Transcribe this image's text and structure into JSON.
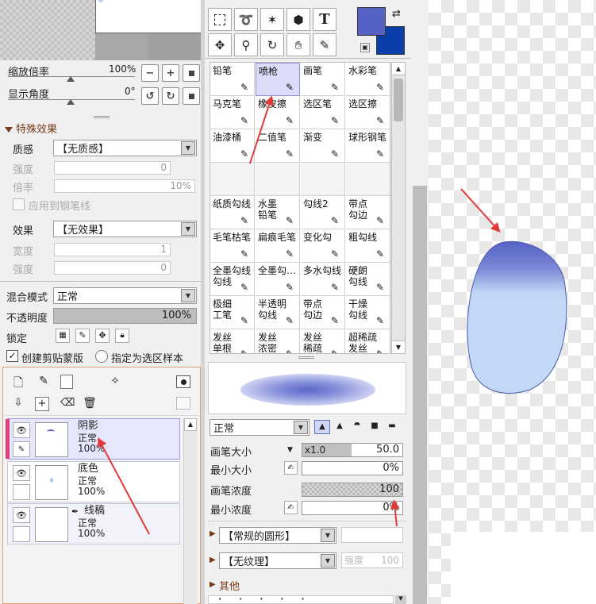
{
  "nav": {
    "zoom_label": "缩放倍率",
    "zoom_value": "100%",
    "angle_label": "显示角度",
    "angle_value": "0°"
  },
  "effects": {
    "section": "特殊效果",
    "texture_label": "质感",
    "texture_value": "【无质感】",
    "strength_label": "强度",
    "strength_value": "0",
    "scale_label": "倍率",
    "scale_value": "10%",
    "apply_ruler": "应用到钢笔线",
    "effect_label": "效果",
    "effect_value": "【无效果】",
    "width_label": "宽度",
    "width_value": "1",
    "strength2_label": "强度",
    "strength2_value": "0"
  },
  "layer_props": {
    "blend_label": "混合模式",
    "blend_value": "正常",
    "opacity_label": "不透明度",
    "opacity_value": "100%",
    "lock_label": "锁定",
    "clip_label": "创建剪贴蒙版",
    "select_sample_label": "指定为选区样本"
  },
  "layers": [
    {
      "name": "阴影",
      "mode": "正常",
      "opacity": "100%"
    },
    {
      "name": "底色",
      "mode": "正常",
      "opacity": "100%"
    },
    {
      "name": "线稿",
      "mode": "正常",
      "opacity": "100%"
    }
  ],
  "tools": {
    "text_tool": "T"
  },
  "colors": {
    "primary": "#5562c4",
    "secondary": "#0a3ea8",
    "accent_arrow": "#e23a3a"
  },
  "brushes": [
    [
      "铅笔",
      "喷枪",
      "画笔",
      "水彩笔"
    ],
    [
      "马克笔",
      "橡皮擦",
      "选区笔",
      "选区擦"
    ],
    [
      "油漆桶",
      "二值笔",
      "渐变",
      "球形钢笔"
    ],
    [
      "",
      "",
      "",
      ""
    ],
    [
      "纸质勾线",
      "水墨\n铅笔",
      "勾线2",
      "带点\n勾边"
    ],
    [
      "毛笔枯笔",
      "扁痕毛笔",
      "变化勾",
      "粗勾线"
    ],
    [
      "全墨勾线\n勾线",
      "全墨勾…",
      "多水勾线",
      "硬朗\n勾线"
    ],
    [
      "极细\n工笔",
      "半透明\n勾线",
      "带点\n勾边",
      "干燥\n勾线"
    ],
    [
      "发丝\n单根",
      "发丝\n浓密",
      "发丝\n稀疏",
      "超稀疏\n发丝"
    ]
  ],
  "brush_settings": {
    "mode_value": "正常",
    "size_label": "画笔大小",
    "size_multiplier": "x1.0",
    "size_value": "50.0",
    "min_size_label": "最小大小",
    "min_size_value": "0%",
    "density_label": "画笔浓度",
    "density_value": "100",
    "min_density_label": "最小浓度",
    "min_density_value": "0%",
    "shape_value": "【常规的圆形】",
    "texture_value": "【无纹理】",
    "texture_strength_label": "强度",
    "texture_strength_value": "100",
    "other_label": "其他"
  }
}
